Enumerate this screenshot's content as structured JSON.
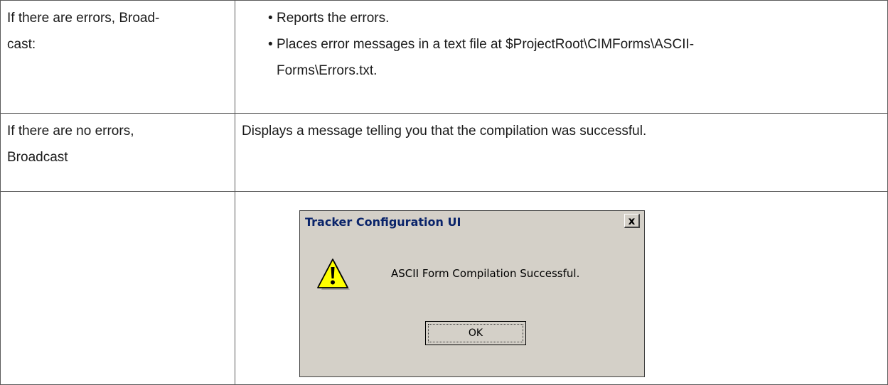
{
  "rows": [
    {
      "condition_line1": "If there are errors, Broad-",
      "condition_line2": "cast:",
      "bullets": [
        {
          "text_line1": "Reports the errors.",
          "text_line2": ""
        },
        {
          "text_line1": "Places error messages in a text file at $ProjectRoot\\CIMForms\\ASCII-",
          "text_line2": "Forms\\Errors.txt."
        }
      ]
    },
    {
      "condition_line1": "If there are no errors,",
      "condition_line2": "Broadcast",
      "description": "Displays a message telling you that the compilation was successful."
    }
  ],
  "dialog": {
    "title": "Tracker Configuration UI",
    "close_label": "x",
    "message": "ASCII Form Compilation Successful.",
    "ok_label": "OK",
    "icon": "warning-icon"
  }
}
